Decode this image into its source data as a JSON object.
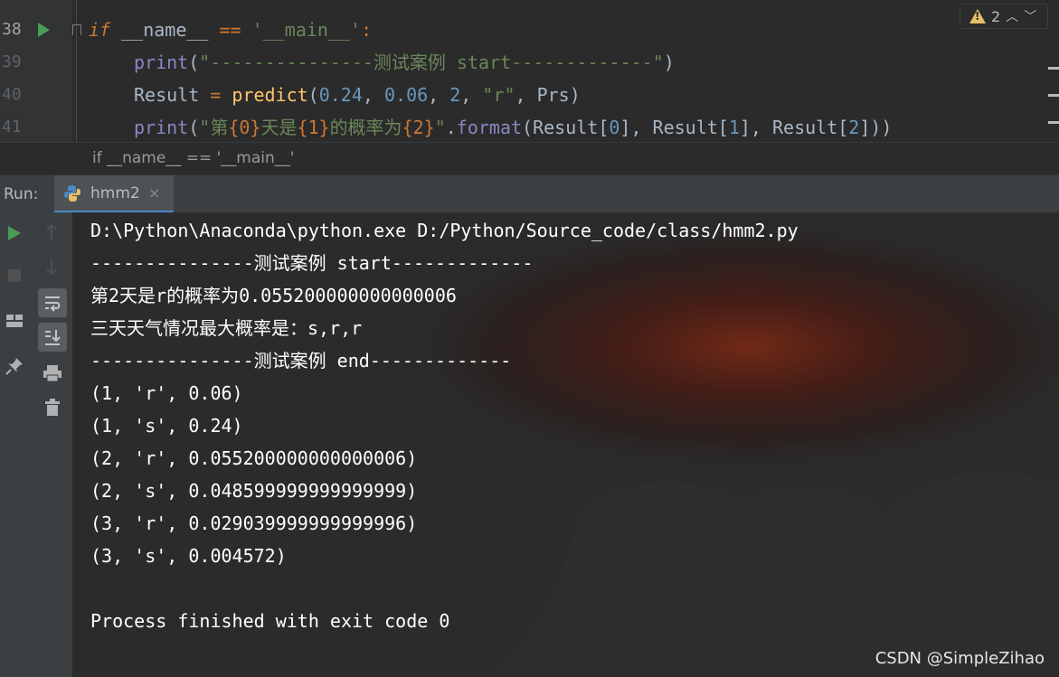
{
  "editor": {
    "lines": [
      {
        "number": "38",
        "has_run_arrow": true
      },
      {
        "number": "39"
      },
      {
        "number": "40"
      },
      {
        "number": "41"
      }
    ],
    "code": {
      "l38_kw": "if",
      "l38_name": " __name__ ",
      "l38_op": "==",
      "l38_str": "'__main__'",
      "l38_colon": ":",
      "l39_fn": "print",
      "l39_open": "(",
      "l39_str_a": "\"---------------",
      "l39_str_cjk": "测试案例",
      "l39_str_b": " start-------------\"",
      "l39_close": ")",
      "l40_var": "Result",
      "l40_eq": " = ",
      "l40_fn": "predict",
      "l40_open": "(",
      "l40_n1": "0.24",
      "l40_c1": ", ",
      "l40_n2": "0.06",
      "l40_c2": ", ",
      "l40_n3": "2",
      "l40_c3": ", ",
      "l40_s": "\"r\"",
      "l40_rest": ", Prs)",
      "l41_fn": "print",
      "l41_open": "(",
      "l41_q": "\"",
      "l41_a": "第",
      "l41_b": "{0}",
      "l41_c": "天是",
      "l41_d": "{1}",
      "l41_e": "的概率为",
      "l41_f": "{2}",
      "l41_q2": "\"",
      "l41_dot": ".",
      "l41_format": "format",
      "l41_p1": "(Result[",
      "l41_i0": "0",
      "l41_p2": "], Result[",
      "l41_i1": "1",
      "l41_p3": "], Result[",
      "l41_i2": "2",
      "l41_p4": "]))"
    },
    "inspection": {
      "count": "2"
    }
  },
  "breadcrumb": {
    "text": "if __name__ == '__main__'"
  },
  "run": {
    "label": "Run:",
    "tab_label": "hmm2",
    "close_glyph": "×"
  },
  "console": {
    "lines": [
      "D:\\Python\\Anaconda\\python.exe D:/Python/Source_code/class/hmm2.py",
      "---------------测试案例 start-------------",
      "第2天是r的概率为0.055200000000000006",
      "三天天气情况最大概率是：s,r,r",
      "---------------测试案例 end-------------",
      "(1, 'r', 0.06)",
      "(1, 's', 0.24)",
      "(2, 'r', 0.055200000000000006)",
      "(2, 's', 0.048599999999999999)",
      "(3, 'r', 0.029039999999999996)",
      "(3, 's', 0.004572)",
      "",
      "Process finished with exit code 0"
    ]
  },
  "watermark": "CSDN @SimpleZihao",
  "colors": {
    "editor_bg": "#2b2b2b",
    "panel_bg": "#3c3f41",
    "accent": "#4a88c7",
    "run_green": "#499c54",
    "warning": "#e8bf6a"
  }
}
